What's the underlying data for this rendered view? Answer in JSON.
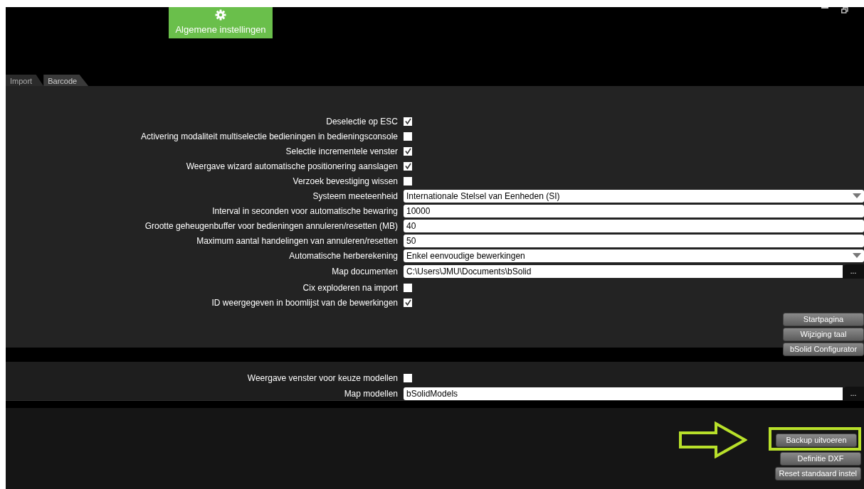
{
  "header": {
    "active_section": {
      "label": "Algemene instellingen"
    }
  },
  "tabs": [
    {
      "label": "Import",
      "selected": false
    },
    {
      "label": "Barcode",
      "selected": true
    }
  ],
  "settings": [
    {
      "kind": "checkbox",
      "label": "Deselectie op ESC",
      "checked": true
    },
    {
      "kind": "checkbox",
      "label": "Activering modaliteit multiselectie bedieningen in bedieningsconsole",
      "checked": false
    },
    {
      "kind": "checkbox",
      "label": "Selectie incrementele venster",
      "checked": true
    },
    {
      "kind": "checkbox",
      "label": "Weergave wizard automatische positionering aanslagen",
      "checked": true
    },
    {
      "kind": "checkbox",
      "label": "Verzoek bevestiging wissen",
      "checked": false
    },
    {
      "kind": "dropdown",
      "label": "Systeem meeteenheid",
      "value": "Internationale Stelsel van Eenheden (SI)"
    },
    {
      "kind": "text",
      "label": "Interval in seconden voor automatische bewaring",
      "value": "10000"
    },
    {
      "kind": "text",
      "label": "Grootte geheugenbuffer voor bedieningen annuleren/resetten (MB)",
      "value": "40"
    },
    {
      "kind": "text",
      "label": "Maximum aantal handelingen van annuleren/resetten",
      "value": "50"
    },
    {
      "kind": "dropdown",
      "label": "Automatische herberekening",
      "value": "Enkel eenvoudige bewerkingen"
    },
    {
      "kind": "path",
      "label": "Map documenten",
      "value": "C:\\Users\\JMU\\Documents\\bSolid",
      "button": "..."
    },
    {
      "kind": "checkbox",
      "label": "Cix exploderen na import",
      "checked": false
    },
    {
      "kind": "checkbox",
      "label": "ID weergegeven in boomlijst van de bewerkingen",
      "checked": true
    }
  ],
  "side_buttons": [
    "Startpagina",
    "Wijziging taal",
    "bSolid Configurator"
  ],
  "model_settings": [
    {
      "kind": "checkbox",
      "label": "Weergave venster voor keuze modellen",
      "checked": false
    },
    {
      "kind": "path",
      "label": "Map modellen",
      "value": "bSolidModels",
      "button": "..."
    }
  ],
  "footer_buttons": [
    {
      "label": "Backup uitvoeren",
      "highlighted": true
    },
    {
      "label": "Definitie DXF",
      "highlighted": false
    },
    {
      "label": "Reset standaard instel",
      "highlighted": false
    }
  ]
}
